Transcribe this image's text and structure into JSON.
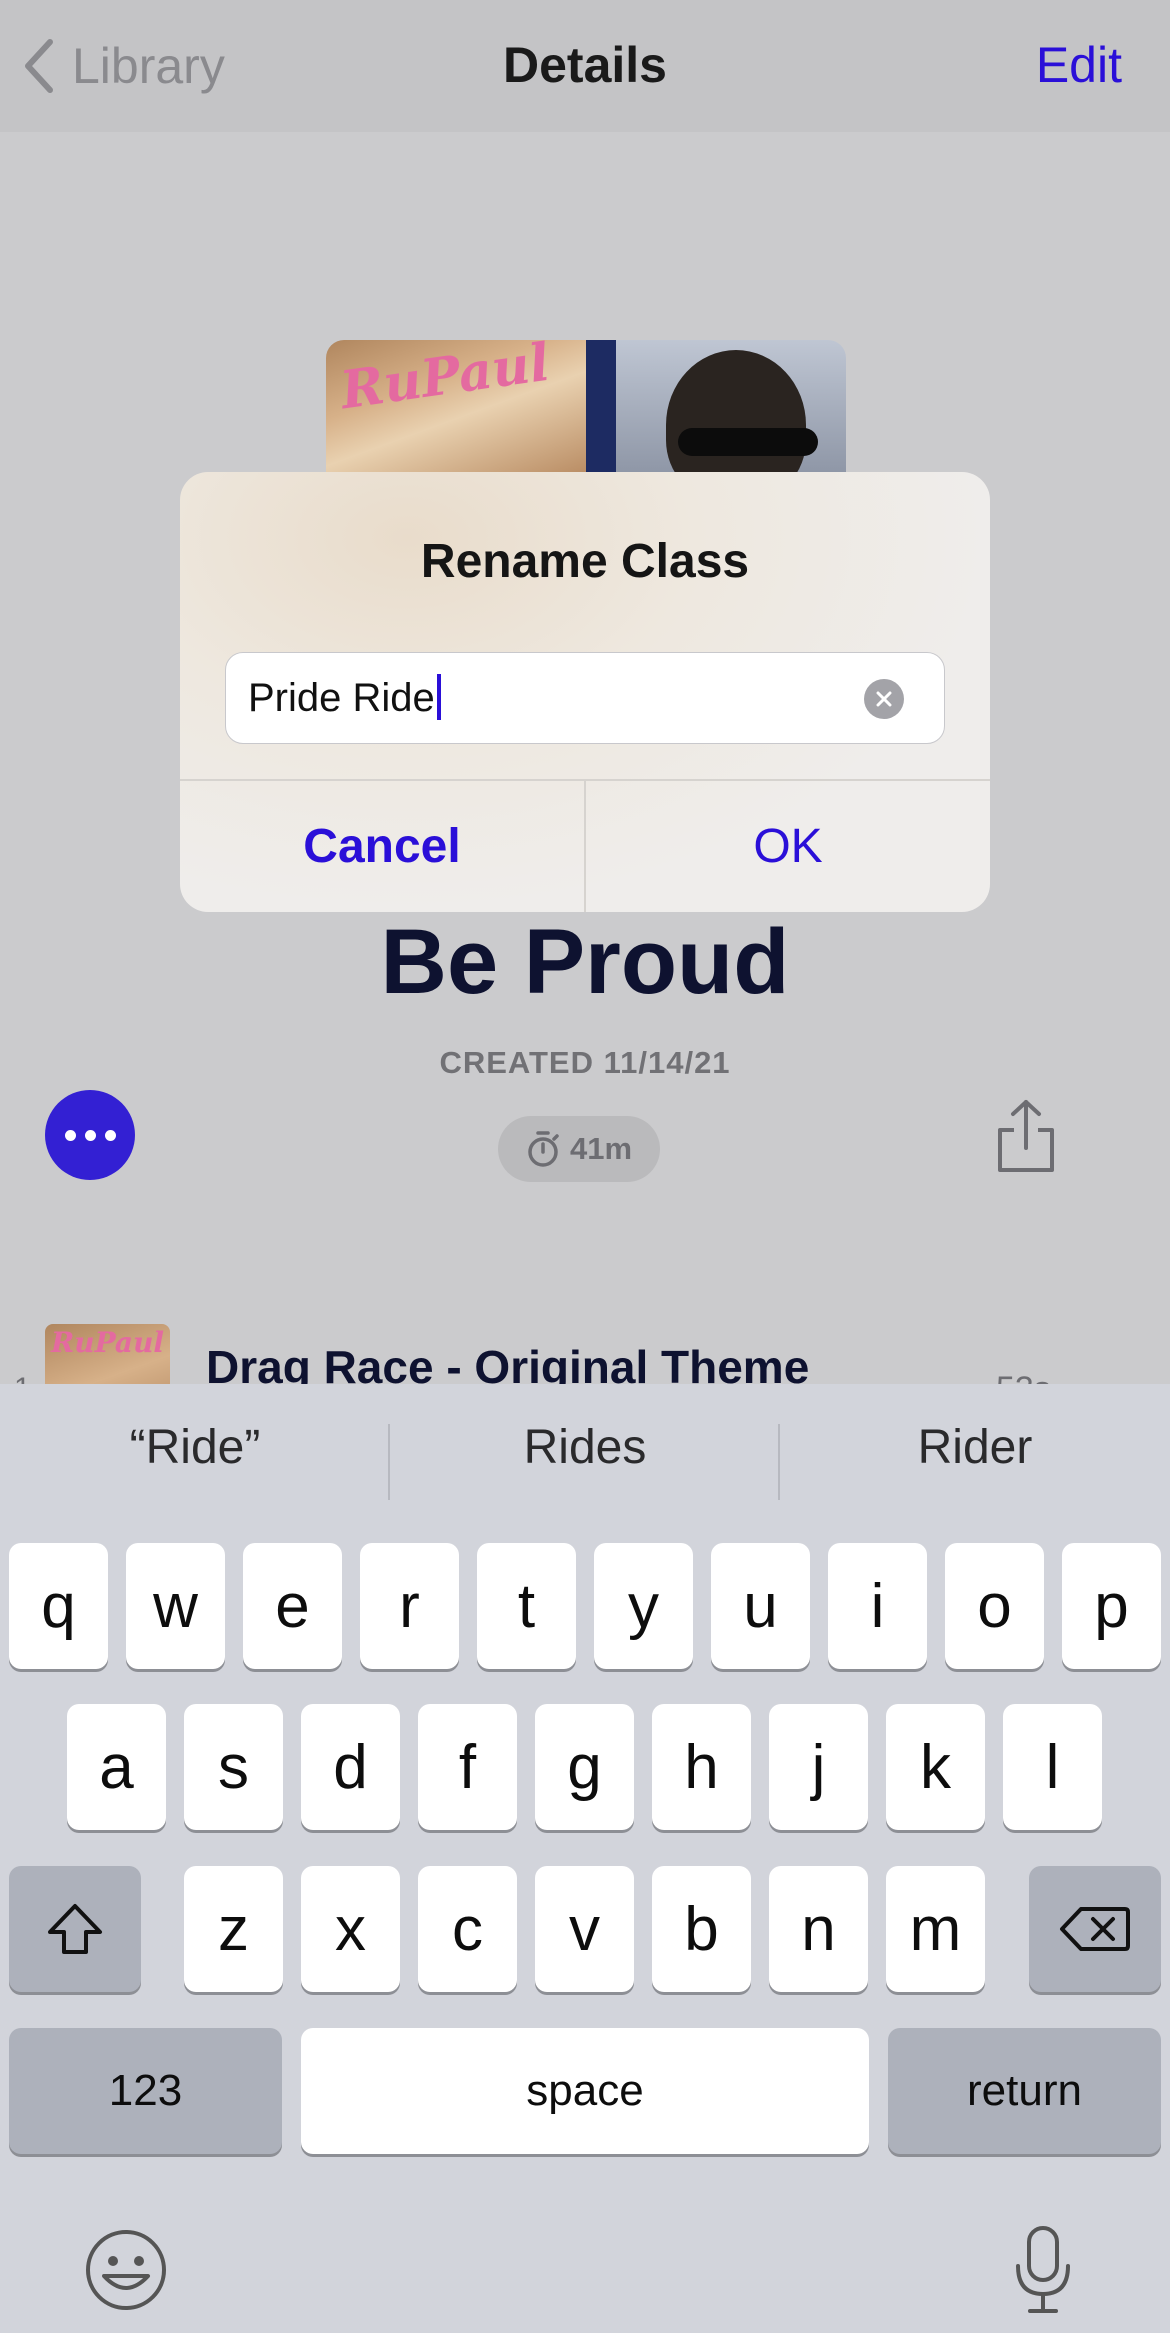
{
  "nav": {
    "back_label": "Library",
    "title": "Details",
    "edit_label": "Edit"
  },
  "artwork": {
    "left_logo": "RuPaul"
  },
  "page": {
    "title": "Be Proud",
    "created": "CREATED 11/14/21",
    "duration": "41m"
  },
  "track": {
    "number": "1",
    "title": "Drag Race - Original Theme",
    "duration": "53s",
    "thumb_logo": "RuPaul"
  },
  "alert": {
    "title": "Rename Class",
    "input_value": "Pride Ride",
    "cancel_label": "Cancel",
    "ok_label": "OK"
  },
  "keyboard": {
    "suggestions": [
      "“Ride”",
      "Rides",
      "Rider"
    ],
    "row1": [
      "q",
      "w",
      "e",
      "r",
      "t",
      "y",
      "u",
      "i",
      "o",
      "p"
    ],
    "row2": [
      "a",
      "s",
      "d",
      "f",
      "g",
      "h",
      "j",
      "k",
      "l"
    ],
    "row3": [
      "z",
      "x",
      "c",
      "v",
      "b",
      "n",
      "m"
    ],
    "numbers_label": "123",
    "space_label": "space",
    "return_label": "return"
  },
  "colors": {
    "accent": "#2a0fd8",
    "more_button": "#3320d3",
    "title_text": "#0e1230"
  },
  "icons": [
    "chevron-left-icon",
    "ellipsis-icon",
    "stopwatch-icon",
    "share-icon",
    "clear-icon",
    "shift-icon",
    "delete-icon",
    "emoji-icon",
    "microphone-icon"
  ]
}
